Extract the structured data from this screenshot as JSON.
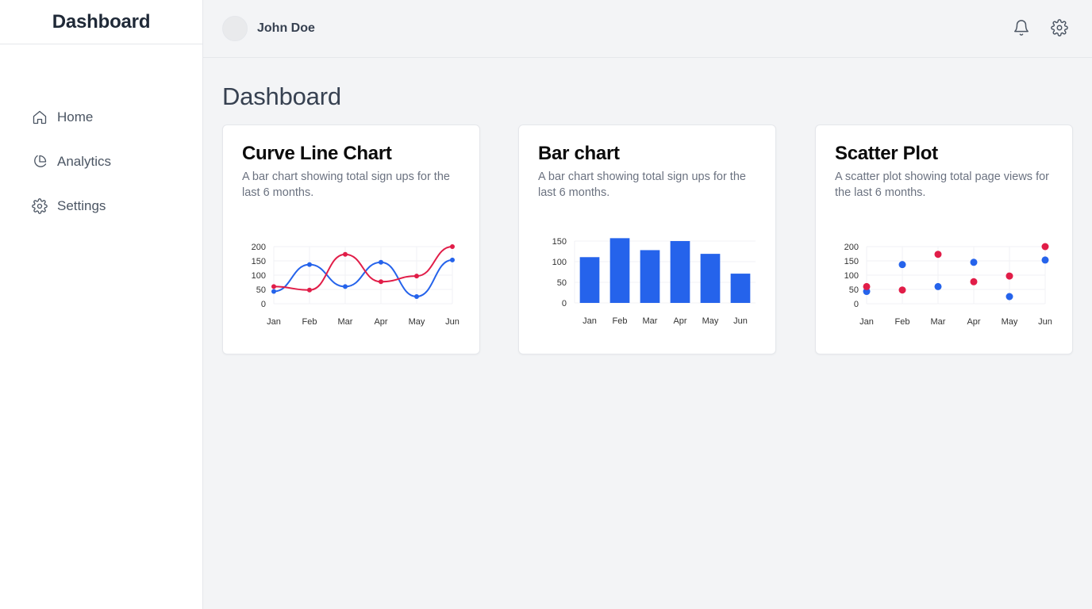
{
  "sidebar": {
    "brand": "Dashboard",
    "items": [
      {
        "label": "Home",
        "icon": "home-icon"
      },
      {
        "label": "Analytics",
        "icon": "pie-chart-icon"
      },
      {
        "label": "Settings",
        "icon": "gear-icon"
      }
    ]
  },
  "header": {
    "user_name": "John Doe",
    "icons": [
      "bell-icon",
      "gear-icon"
    ]
  },
  "main": {
    "title": "Dashboard"
  },
  "colors": {
    "blue": "#2563eb",
    "red": "#e11d48",
    "grid": "#f1f2f4",
    "axis": "#d1d5db"
  },
  "cards": [
    {
      "title": "Curve Line Chart",
      "description": "A bar chart showing total sign ups for the last 6 months."
    },
    {
      "title": "Bar chart",
      "description": "A bar chart showing total sign ups for the last 6 months."
    },
    {
      "title": "Scatter Plot",
      "description": "A scatter plot showing total page views for the last 6 months."
    }
  ],
  "chart_data": [
    {
      "type": "line",
      "title": "Curve Line Chart",
      "categories": [
        "Jan",
        "Feb",
        "Mar",
        "Apr",
        "May",
        "Jun"
      ],
      "yticks": [
        0,
        50,
        100,
        150,
        200
      ],
      "ylim": [
        0,
        200
      ],
      "grid": true,
      "series": [
        {
          "values": [
            43,
            137,
            60,
            145,
            25,
            153
          ]
        },
        {
          "values": [
            60,
            48,
            173,
            77,
            97,
            200
          ]
        }
      ]
    },
    {
      "type": "bar",
      "title": "Bar chart",
      "categories": [
        "Jan",
        "Feb",
        "Mar",
        "Apr",
        "May",
        "Jun"
      ],
      "yticks": [
        0,
        50,
        100,
        150
      ],
      "ylim": [
        0,
        150
      ],
      "grid": true,
      "values": [
        111,
        157,
        128,
        150,
        119,
        71
      ]
    },
    {
      "type": "scatter",
      "title": "Scatter Plot",
      "categories": [
        "Jan",
        "Feb",
        "Mar",
        "Apr",
        "May",
        "Jun"
      ],
      "yticks": [
        0,
        50,
        100,
        150,
        200
      ],
      "ylim": [
        0,
        200
      ],
      "grid": true,
      "series": [
        {
          "values": [
            43,
            137,
            60,
            145,
            25,
            153
          ]
        },
        {
          "values": [
            60,
            48,
            173,
            77,
            97,
            200
          ]
        }
      ]
    }
  ]
}
